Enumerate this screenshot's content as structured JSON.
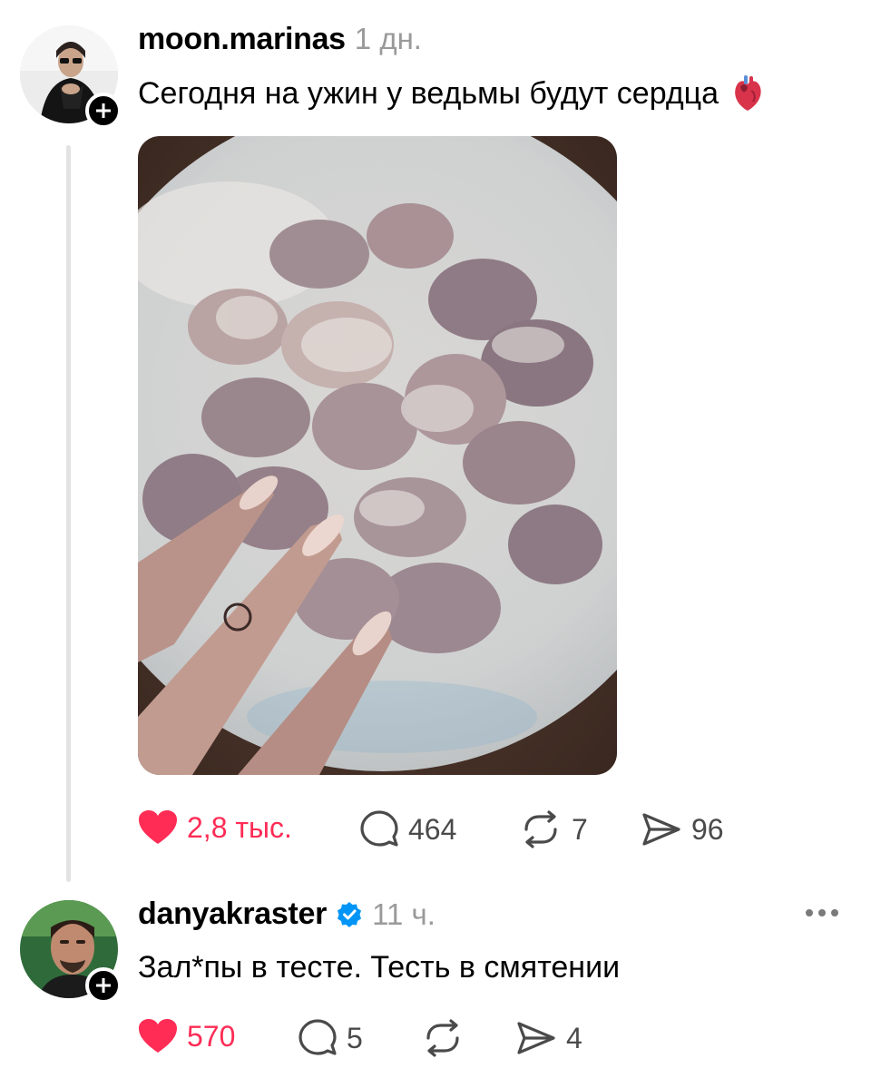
{
  "posts": [
    {
      "username": "moon.marinas",
      "time": "1 дн.",
      "text": "Сегодня на ужин у ведьмы будут сердца",
      "emoji": "anatomical-heart-icon",
      "likes": "2,8 тыс.",
      "comments": "464",
      "reposts": "7",
      "shares": "96",
      "liked": true
    },
    {
      "username": "danyakraster",
      "verified": true,
      "time": "11 ч.",
      "text": "Зал*пы в тесте. Тесть в смятении",
      "likes": "570",
      "comments": "5",
      "reposts": "",
      "shares": "4",
      "liked": true
    }
  ],
  "colors": {
    "like": "#ff2c55",
    "verified": "#0095f6",
    "muted": "#9a9a9a"
  }
}
